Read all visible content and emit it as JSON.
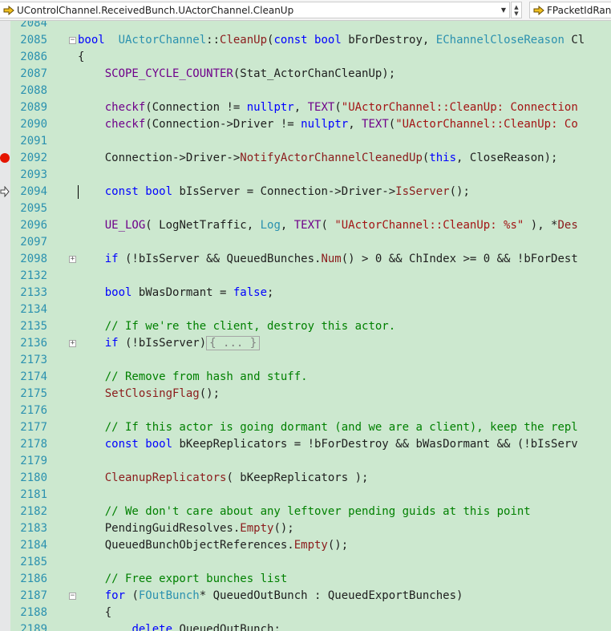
{
  "toolbar": {
    "scope_path": "UControlChannel.ReceivedBunch.UActorChannel.CleanUp",
    "member": "FPacketIdRange"
  },
  "lines": [
    {
      "n": "2084",
      "tokens": []
    },
    {
      "n": "2085",
      "fold": "−",
      "tokens": [
        [
          "kw",
          "bool"
        ],
        [
          "",
          "  "
        ],
        [
          "ty",
          "UActorChannel"
        ],
        [
          "",
          "::"
        ],
        [
          "fn",
          "CleanUp"
        ],
        [
          "",
          "("
        ],
        [
          "kw",
          "const bool"
        ],
        [
          "",
          " bForDestroy, "
        ],
        [
          "ty",
          "EChannelCloseReason"
        ],
        [
          "",
          " Cl"
        ]
      ]
    },
    {
      "n": "2086",
      "tokens": [
        [
          "",
          "{"
        ]
      ]
    },
    {
      "n": "2087",
      "tokens": [
        [
          "",
          "    "
        ],
        [
          "mc",
          "SCOPE_CYCLE_COUNTER"
        ],
        [
          "",
          "(Stat_ActorChanCleanUp);"
        ]
      ]
    },
    {
      "n": "2088",
      "tokens": []
    },
    {
      "n": "2089",
      "tokens": [
        [
          "",
          "    "
        ],
        [
          "mc",
          "checkf"
        ],
        [
          "",
          "(Connection != "
        ],
        [
          "kw",
          "nullptr"
        ],
        [
          "",
          ", "
        ],
        [
          "mc",
          "TEXT"
        ],
        [
          "",
          "("
        ],
        [
          "st",
          "\"UActorChannel::CleanUp: Connection"
        ]
      ]
    },
    {
      "n": "2090",
      "tokens": [
        [
          "",
          "    "
        ],
        [
          "mc",
          "checkf"
        ],
        [
          "",
          "(Connection->Driver != "
        ],
        [
          "kw",
          "nullptr"
        ],
        [
          "",
          ", "
        ],
        [
          "mc",
          "TEXT"
        ],
        [
          "",
          "("
        ],
        [
          "st",
          "\"UActorChannel::CleanUp: Co"
        ]
      ]
    },
    {
      "n": "2091",
      "tokens": []
    },
    {
      "n": "2092",
      "bp": true,
      "tokens": [
        [
          "",
          "    Connection->Driver->"
        ],
        [
          "fn",
          "NotifyActorChannelCleanedUp"
        ],
        [
          "",
          "("
        ],
        [
          "kw",
          "this"
        ],
        [
          "",
          ", CloseReason);"
        ]
      ]
    },
    {
      "n": "2093",
      "tokens": []
    },
    {
      "n": "2094",
      "ptr": true,
      "caret": true,
      "tokens": [
        [
          "",
          "    "
        ],
        [
          "kw",
          "const bool"
        ],
        [
          "",
          " bIsServer = Connection->Driver->"
        ],
        [
          "fn",
          "IsServer"
        ],
        [
          "",
          "();"
        ]
      ]
    },
    {
      "n": "2095",
      "tokens": []
    },
    {
      "n": "2096",
      "tokens": [
        [
          "",
          "    "
        ],
        [
          "mc",
          "UE_LOG"
        ],
        [
          "",
          "( LogNetTraffic, "
        ],
        [
          "ty",
          "Log"
        ],
        [
          "",
          ", "
        ],
        [
          "mc",
          "TEXT"
        ],
        [
          "",
          "( "
        ],
        [
          "st",
          "\"UActorChannel::CleanUp: %s\""
        ],
        [
          "",
          " ), *"
        ],
        [
          "fn",
          "Des"
        ]
      ]
    },
    {
      "n": "2097",
      "tokens": []
    },
    {
      "n": "2098",
      "fold": "+",
      "tokens": [
        [
          "",
          "    "
        ],
        [
          "kw",
          "if"
        ],
        [
          "",
          " (!bIsServer && QueuedBunches."
        ],
        [
          "fn",
          "Num"
        ],
        [
          "",
          "() > 0 && ChIndex >= 0 && !bForDest"
        ]
      ]
    },
    {
      "n": "2132",
      "tokens": []
    },
    {
      "n": "2133",
      "tokens": [
        [
          "",
          "    "
        ],
        [
          "kw",
          "bool"
        ],
        [
          "",
          " bWasDormant = "
        ],
        [
          "kw",
          "false"
        ],
        [
          "",
          ";"
        ]
      ]
    },
    {
      "n": "2134",
      "tokens": []
    },
    {
      "n": "2135",
      "tokens": [
        [
          "",
          "    "
        ],
        [
          "cm",
          "// If we're the client, destroy this actor."
        ]
      ]
    },
    {
      "n": "2136",
      "fold": "+",
      "tokens": [
        [
          "",
          "    "
        ],
        [
          "kw",
          "if"
        ],
        [
          "",
          " (!bIsServer)"
        ],
        [
          "collapsed",
          "{ ... }"
        ]
      ]
    },
    {
      "n": "2173",
      "tokens": []
    },
    {
      "n": "2174",
      "tokens": [
        [
          "",
          "    "
        ],
        [
          "cm",
          "// Remove from hash and stuff."
        ]
      ]
    },
    {
      "n": "2175",
      "tokens": [
        [
          "",
          "    "
        ],
        [
          "fn",
          "SetClosingFlag"
        ],
        [
          "",
          "();"
        ]
      ]
    },
    {
      "n": "2176",
      "tokens": []
    },
    {
      "n": "2177",
      "tokens": [
        [
          "",
          "    "
        ],
        [
          "cm",
          "// If this actor is going dormant (and we are a client), keep the repl"
        ]
      ]
    },
    {
      "n": "2178",
      "tokens": [
        [
          "",
          "    "
        ],
        [
          "kw",
          "const bool"
        ],
        [
          "",
          " bKeepReplicators = !bForDestroy && bWasDormant && (!bIsServ"
        ]
      ]
    },
    {
      "n": "2179",
      "tokens": []
    },
    {
      "n": "2180",
      "tokens": [
        [
          "",
          "    "
        ],
        [
          "fn",
          "CleanupReplicators"
        ],
        [
          "",
          "( bKeepReplicators );"
        ]
      ]
    },
    {
      "n": "2181",
      "tokens": []
    },
    {
      "n": "2182",
      "tokens": [
        [
          "",
          "    "
        ],
        [
          "cm",
          "// We don't care about any leftover pending guids at this point"
        ]
      ]
    },
    {
      "n": "2183",
      "tokens": [
        [
          "",
          "    PendingGuidResolves."
        ],
        [
          "fn",
          "Empty"
        ],
        [
          "",
          "();"
        ]
      ]
    },
    {
      "n": "2184",
      "tokens": [
        [
          "",
          "    QueuedBunchObjectReferences."
        ],
        [
          "fn",
          "Empty"
        ],
        [
          "",
          "();"
        ]
      ]
    },
    {
      "n": "2185",
      "tokens": []
    },
    {
      "n": "2186",
      "tokens": [
        [
          "",
          "    "
        ],
        [
          "cm",
          "// Free export bunches list"
        ]
      ]
    },
    {
      "n": "2187",
      "fold": "−",
      "tokens": [
        [
          "",
          "    "
        ],
        [
          "kw",
          "for"
        ],
        [
          "",
          " ("
        ],
        [
          "ty",
          "FOutBunch"
        ],
        [
          "",
          "* QueuedOutBunch : QueuedExportBunches)"
        ]
      ]
    },
    {
      "n": "2188",
      "tokens": [
        [
          "",
          "    {"
        ]
      ]
    },
    {
      "n": "2189",
      "tokens": [
        [
          "",
          "        "
        ],
        [
          "kw",
          "delete"
        ],
        [
          "",
          " QueuedOutBunch;"
        ]
      ]
    }
  ]
}
